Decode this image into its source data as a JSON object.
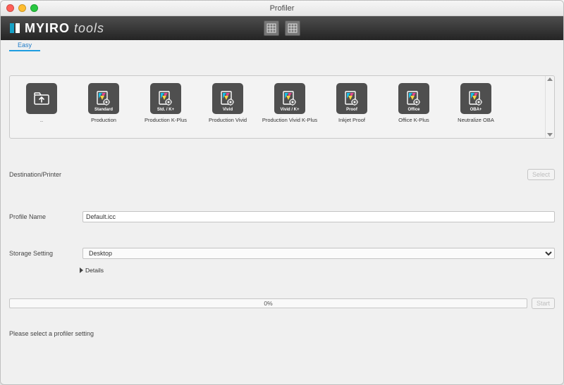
{
  "window": {
    "title": "Profiler"
  },
  "brand": {
    "bold": "MYIRO",
    "light": "tools"
  },
  "tabs": [
    {
      "label": "Easy",
      "active": true
    }
  ],
  "profiles": [
    {
      "tile": "",
      "caption": ".."
    },
    {
      "tile": "Standard",
      "caption": "Production"
    },
    {
      "tile": "Std. / K+",
      "caption": "Production K-Plus"
    },
    {
      "tile": "Vivid",
      "caption": "Production Vivid"
    },
    {
      "tile": "Vivid / K+",
      "caption": "Production Vivid K-Plus"
    },
    {
      "tile": "Proof",
      "caption": "Inkjet Proof"
    },
    {
      "tile": "Office",
      "caption": "Office K-Plus"
    },
    {
      "tile": "OBA+",
      "caption": "Neutralize OBA"
    }
  ],
  "form": {
    "destination_label": "Destination/Printer",
    "select_btn": "Select",
    "profile_name_label": "Profile Name",
    "profile_name_value": "Default.icc",
    "storage_label": "Storage Setting",
    "storage_value": "Desktop",
    "details_label": "Details"
  },
  "progress": {
    "text": "0%",
    "start_btn": "Start"
  },
  "hint": "Please select a profiler setting"
}
